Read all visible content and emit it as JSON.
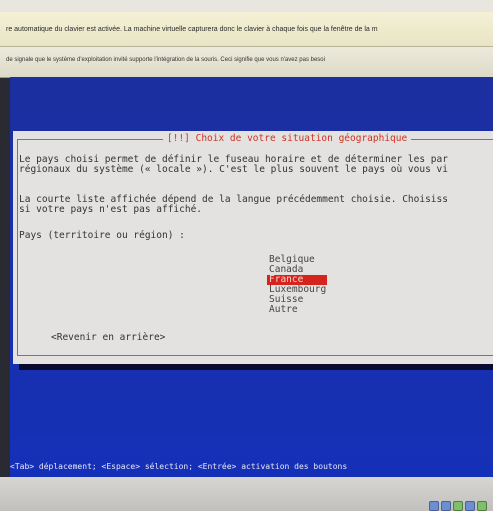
{
  "host": {
    "notice1": "re automatique du clavier est activée. La machine virtuelle capturera donc le clavier à chaque fois que la fenêtre de la m",
    "notice2": "de signale que le système d'exploitation invité supporte l'intégration de la souris. Ceci signifie que vous n'avez pas besoi"
  },
  "dialog": {
    "title": "[!!] Choix de votre situation géographique",
    "para1_line1": "Le pays choisi permet de définir le fuseau horaire et de déterminer les par",
    "para1_line2": "régionaux du système (« locale »). C'est le plus souvent le pays où vous vi",
    "para2_line1": "La courte liste affichée dépend de la langue précédemment choisie. Choisiss",
    "para2_line2": "si votre pays n'est pas affiché.",
    "prompt": "Pays (territoire ou région) :",
    "countries": [
      "Belgique",
      "Canada",
      "France",
      "Luxembourg",
      "Suisse",
      "Autre"
    ],
    "selected": "France",
    "back_button": "<Revenir en arrière>"
  },
  "help_line": "<Tab> déplacement; <Espace> sélection; <Entrée> activation des boutons",
  "colors": {
    "screen_blue": "#1a2fa8",
    "dialog_bg": "#e4e2e0",
    "title_red": "#cc3322",
    "selection_red": "#d4241c"
  },
  "icons": [
    "tray-icons"
  ]
}
